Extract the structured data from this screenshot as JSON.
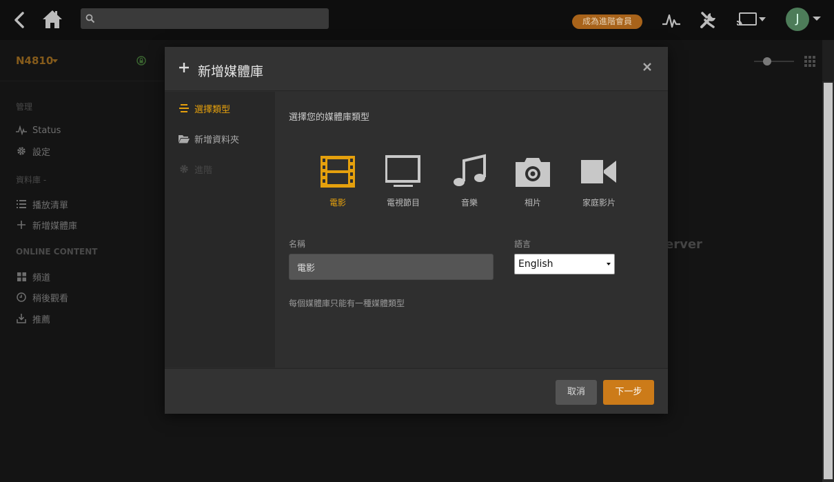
{
  "topbar": {
    "search_placeholder": "",
    "premium_label": "成為進階會員",
    "avatar_initial": "J"
  },
  "sidebar": {
    "server_name": "N4810",
    "manage_title": "管理",
    "manage_items": [
      {
        "label": "Status",
        "icon": "activity-icon"
      },
      {
        "label": "設定",
        "icon": "gear-icon"
      }
    ],
    "library_title": "資料庫 -",
    "library_items": [
      {
        "label": "播放清單",
        "icon": "list-icon"
      },
      {
        "label": "新增媒體庫",
        "icon": "plus-icon"
      }
    ],
    "online_title": "ONLINE CONTENT",
    "online_items": [
      {
        "label": "頻道",
        "icon": "grid-icon"
      },
      {
        "label": "稍後觀看",
        "icon": "clock-icon"
      },
      {
        "label": "推薦",
        "icon": "download-icon"
      }
    ]
  },
  "background_text": "erver",
  "modal": {
    "title": "新增媒體庫",
    "steps": [
      {
        "label": "選擇類型",
        "state": "active"
      },
      {
        "label": "新增資料夾",
        "state": "normal"
      },
      {
        "label": "進階",
        "state": "disabled"
      }
    ],
    "prompt": "選擇您的媒體庫類型",
    "types": [
      {
        "label": "電影",
        "icon": "film-icon",
        "active": true
      },
      {
        "label": "電視節目",
        "icon": "tv-icon",
        "active": false
      },
      {
        "label": "音樂",
        "icon": "music-icon",
        "active": false
      },
      {
        "label": "相片",
        "icon": "camera-icon",
        "active": false
      },
      {
        "label": "家庭影片",
        "icon": "video-camera-icon",
        "active": false
      }
    ],
    "name_label": "名稱",
    "name_value": "電影",
    "language_label": "語言",
    "language_value": "English",
    "hint": "每個媒體庫只能有一種媒體類型",
    "cancel_label": "取消",
    "next_label": "下一步"
  },
  "colors": {
    "accent": "#e5a00d",
    "button_primary": "#cc7b19",
    "premium_badge": "#a8631a",
    "avatar": "#4d7c59",
    "lock": "#5a9a4a"
  }
}
